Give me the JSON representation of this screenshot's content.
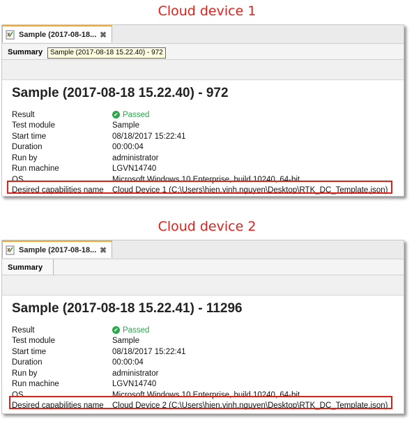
{
  "panels": [
    {
      "caption": "Cloud device 1",
      "tab_title": "Sample (2017-08-18...",
      "summary_tab": "Summary",
      "tooltip": "Sample (2017-08-18 15.22.40) - 972",
      "title": "Sample (2017-08-18 15.22.40) - 972",
      "rows": {
        "result_label": "Result",
        "result_value": "Passed",
        "module_label": "Test module",
        "module_value": "Sample",
        "start_label": "Start time",
        "start_value": "08/18/2017 15:22:41",
        "duration_label": "Duration",
        "duration_value": "00:00:04",
        "runby_label": "Run by",
        "runby_value": "administrator",
        "machine_label": "Run machine",
        "machine_value": "LGVN14740",
        "os_label": "OS",
        "os_value": "Microsoft Windows 10 Enterprise, build 10240, 64-bit",
        "caps_label": "Desired capabilities name",
        "caps_value": "Cloud Device 1 (C:\\Users\\hien.vinh.nguyen\\Desktop\\RTK_DC_Template.json)"
      }
    },
    {
      "caption": "Cloud device 2",
      "tab_title": "Sample (2017-08-18...",
      "summary_tab": "Summary",
      "title": "Sample (2017-08-18 15.22.41) - 11296",
      "rows": {
        "result_label": "Result",
        "result_value": "Passed",
        "module_label": "Test module",
        "module_value": "Sample",
        "start_label": "Start time",
        "start_value": "08/18/2017 15:22:41",
        "duration_label": "Duration",
        "duration_value": "00:00:04",
        "runby_label": "Run by",
        "runby_value": "administrator",
        "machine_label": "Run machine",
        "machine_value": "LGVN14740",
        "os_label": "OS",
        "os_value": "Microsoft Windows 10 Enterprise, build 10240, 64-bit",
        "caps_label": "Desired capabilities name",
        "caps_value": "Cloud Device 2 (C:\\Users\\hien.vinh.nguyen\\Desktop\\RTK_DC_Template.json)"
      }
    }
  ],
  "colors": {
    "caption": "#e0211b",
    "highlight": "#e0211b",
    "passed": "#2aa84a",
    "tab_accent": "#f0a830"
  },
  "icons": {
    "doc": "report-doc-icon",
    "close": "close-icon",
    "passed": "check-circle-icon"
  }
}
